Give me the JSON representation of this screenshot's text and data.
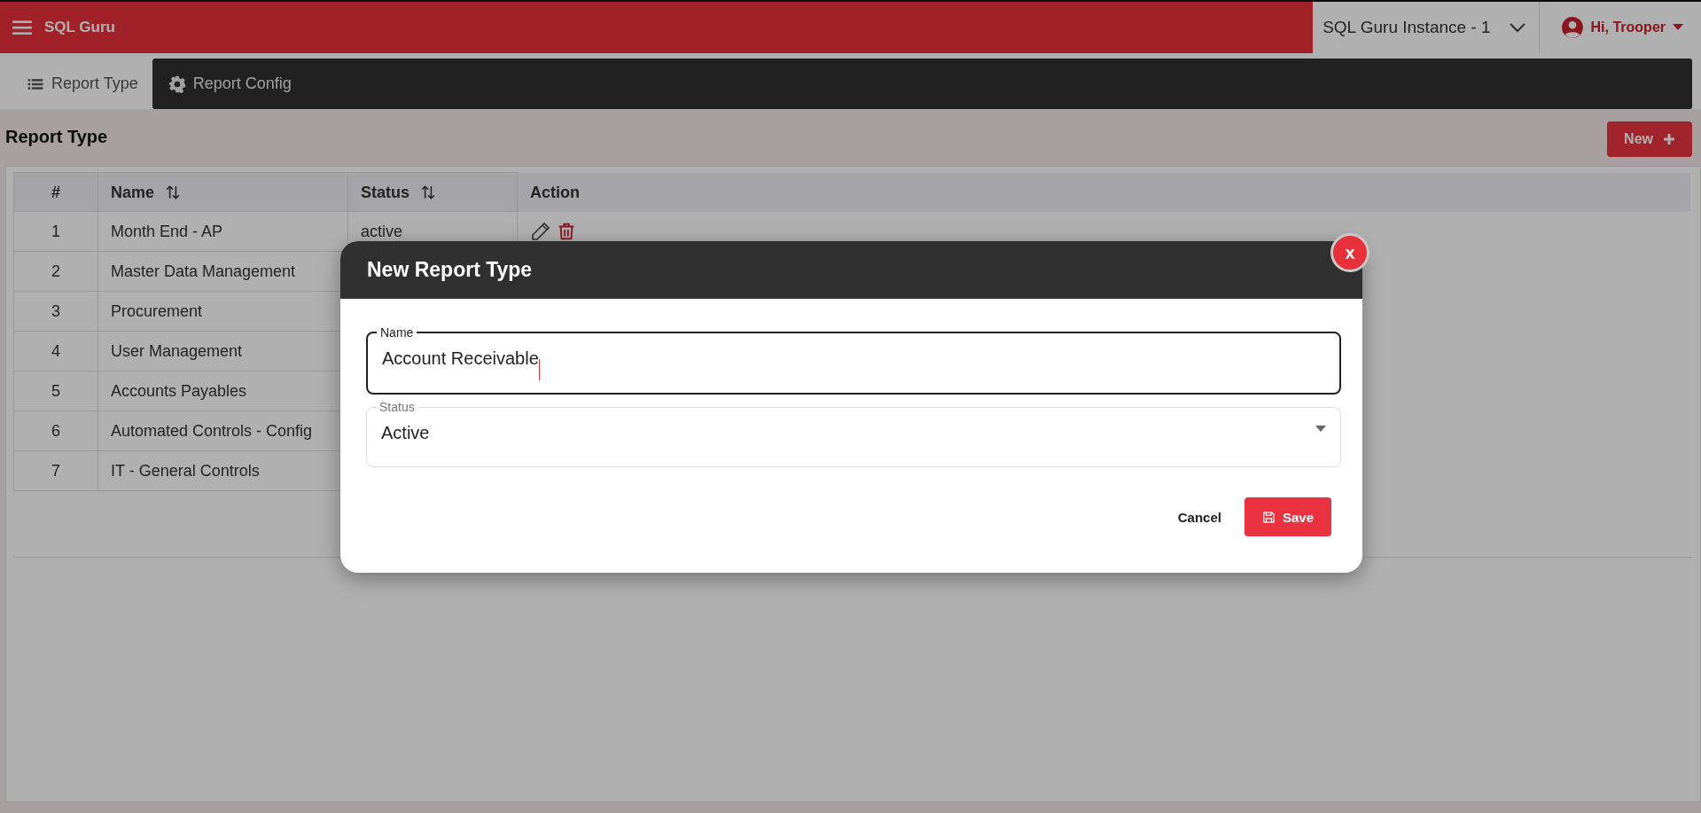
{
  "app_bar": {
    "title": "SQL Guru",
    "instance": "SQL Guru Instance - 1",
    "user": "Hi, Trooper"
  },
  "tabs": [
    {
      "label": "Report Type",
      "kind": "list",
      "selected": true
    },
    {
      "label": "Report Config",
      "kind": "config",
      "selected": false
    }
  ],
  "page": {
    "title": "Report Type",
    "new_button": "New"
  },
  "table": {
    "columns": [
      {
        "label": "#",
        "sortable": false
      },
      {
        "label": "Name",
        "sortable": true
      },
      {
        "label": "Status",
        "sortable": true
      },
      {
        "label": "Action",
        "sortable": false
      }
    ],
    "rows": [
      {
        "index": "1",
        "name": "Month End - AP",
        "status": "active",
        "actions": true
      },
      {
        "index": "2",
        "name": "Master Data Management"
      },
      {
        "index": "3",
        "name": "Procurement"
      },
      {
        "index": "4",
        "name": "User Management"
      },
      {
        "index": "5",
        "name": "Accounts Payables"
      },
      {
        "index": "6",
        "name": "Automated Controls - Config"
      },
      {
        "index": "7",
        "name": "IT - General Controls"
      }
    ]
  },
  "dialog": {
    "title": "New Report Type",
    "close": "x",
    "fields": [
      {
        "kind": "text",
        "label": "Name",
        "value": "Account Receivable",
        "focused": true
      },
      {
        "kind": "select",
        "label": "Status",
        "value": "Active",
        "focused": false
      }
    ],
    "buttons": [
      {
        "kind": "text",
        "label": "Cancel"
      },
      {
        "kind": "primary",
        "label": "Save"
      }
    ]
  }
}
